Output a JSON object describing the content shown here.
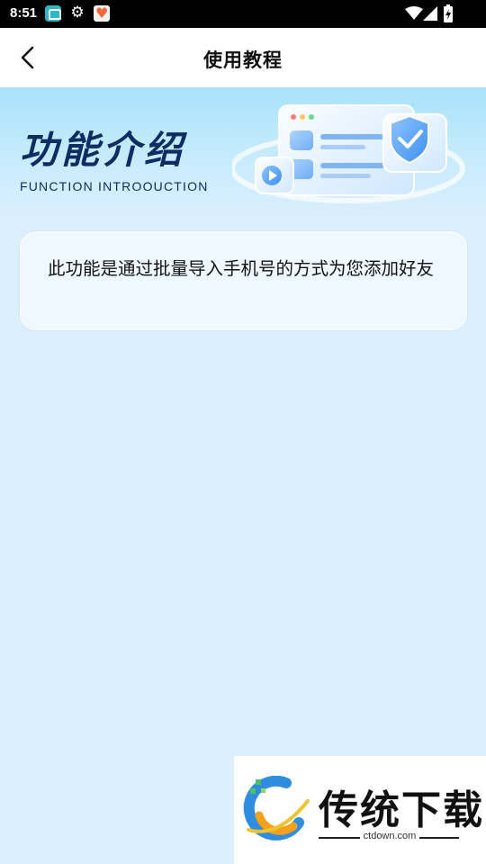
{
  "status_bar": {
    "time": "8:51",
    "icons": [
      "app-icon",
      "gear-icon",
      "heart-app-icon",
      "wifi-icon",
      "signal-icon",
      "battery-icon"
    ]
  },
  "app_bar": {
    "back_icon": "chevron-left-icon",
    "title": "使用教程"
  },
  "banner": {
    "title": "功能介绍",
    "subtitle": "FUNCTION INTROOUCTION",
    "illustration": "browser-window-with-shield-icon"
  },
  "intro_card": {
    "text": "此功能是通过批量导入手机号的方式为您添加好友"
  },
  "watermark": {
    "name": "传统下载",
    "url": "ctdown.com"
  },
  "colors": {
    "background": "#dcefff",
    "banner_title": "#0e2d63",
    "accent_blue": "#3d8ff2"
  }
}
